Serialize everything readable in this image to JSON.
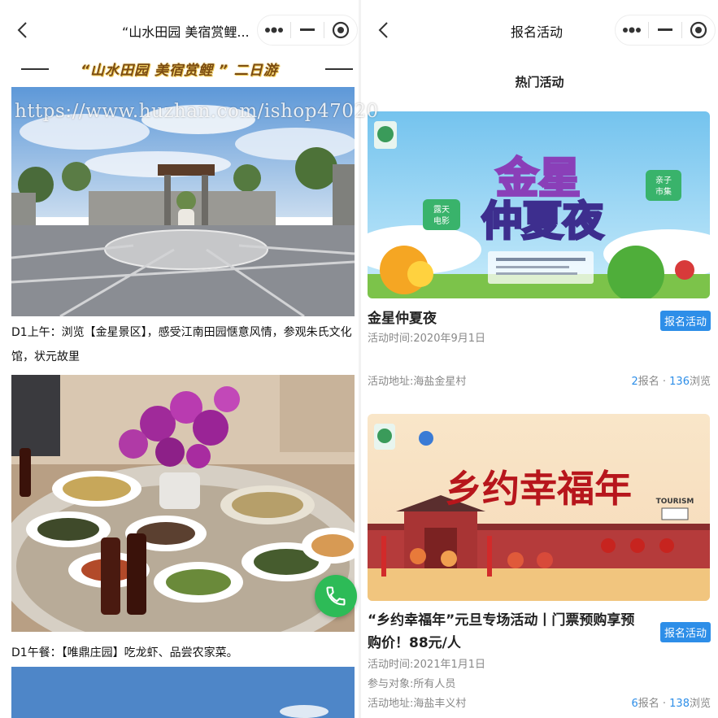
{
  "watermark": "https://www.huzhan.com/ishop47020",
  "left": {
    "nav_title": "“山水田园 美宿赏鲤...",
    "route_title": "“山水田园 美宿赏鲤 ” 二日游",
    "caption1": "D1上午：浏览【金星景区】，感受江南田园惬意风情，参观朱氏文化馆，状元故里",
    "caption2": "D1午餐：【唯鼎庄园】吃龙虾、品尝农家菜。"
  },
  "right": {
    "nav_title": "报名活动",
    "section_title": "热门活动",
    "activities": [
      {
        "title": "金星仲夏夜",
        "tag": "报名活动",
        "time": "活动时间:2020年9月1日",
        "address": "活动地址:海盐金星村",
        "signups": "2",
        "signups_label": "报名 · ",
        "views": "136",
        "views_label": "浏览",
        "banner_title_1": "金星",
        "banner_title_2": "仲夏夜",
        "banner_badge_1": "露天电影",
        "banner_badge_2": "亲子市集"
      },
      {
        "title": "“乡约幸福年”元旦专场活动丨门票预购享预购价！88元/人",
        "tag": "报名活动",
        "time": "活动时间:2021年1月1日",
        "target": "参与对象:所有人员",
        "address": "活动地址:海盐丰义村",
        "signups": "6",
        "signups_label": "报名 · ",
        "views": "138",
        "views_label": "浏览",
        "banner_title": "乡约幸福年",
        "banner_corner": "TOURISM"
      }
    ]
  },
  "colors": {
    "accent_blue": "#2d8ee8",
    "call_green": "#2dbb57",
    "route_text": "#7a4b12"
  },
  "icons": {
    "back": "chevron-left-icon",
    "more": "more-dots-icon",
    "minimize": "minimize-icon",
    "close": "target-close-icon",
    "call": "phone-icon"
  }
}
